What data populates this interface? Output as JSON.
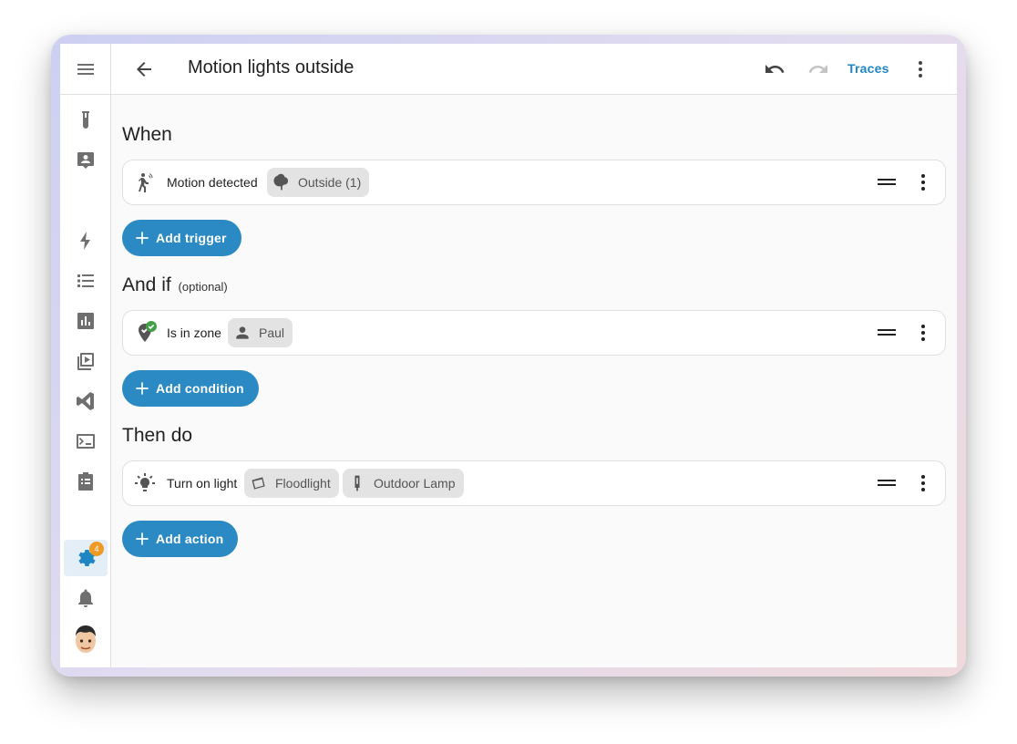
{
  "header": {
    "title": "Motion lights outside",
    "traces_label": "Traces"
  },
  "sidebar": {
    "items": [
      {
        "icon": "test-tube-icon"
      },
      {
        "icon": "account-box-icon"
      },
      {
        "icon": "flash-icon"
      },
      {
        "icon": "list-icon"
      },
      {
        "icon": "bar-chart-icon"
      },
      {
        "icon": "media-play-icon"
      },
      {
        "icon": "vscode-icon"
      },
      {
        "icon": "terminal-icon"
      },
      {
        "icon": "clipboard-icon"
      }
    ],
    "settings_badge": "4",
    "accent_color": "#1f86c4",
    "badge_color": "#ef9a24"
  },
  "sections": {
    "when": {
      "heading": "When",
      "card": {
        "text": "Motion detected",
        "chips": [
          {
            "label": "Outside (1)",
            "icon": "tree-icon"
          }
        ]
      },
      "add_button": "Add trigger"
    },
    "and_if": {
      "heading": "And if",
      "heading_note": "(optional)",
      "card": {
        "text": "Is in zone",
        "chips": [
          {
            "label": "Paul",
            "icon": "person-icon"
          }
        ]
      },
      "add_button": "Add condition"
    },
    "then_do": {
      "heading": "Then do",
      "card": {
        "text": "Turn on light",
        "chips": [
          {
            "label": "Floodlight",
            "icon": "floodlight-icon"
          },
          {
            "label": "Outdoor Lamp",
            "icon": "outdoor-lamp-icon"
          }
        ]
      },
      "add_button": "Add action"
    }
  },
  "colors": {
    "primary": "#2b8ac3",
    "success": "#43a047"
  }
}
